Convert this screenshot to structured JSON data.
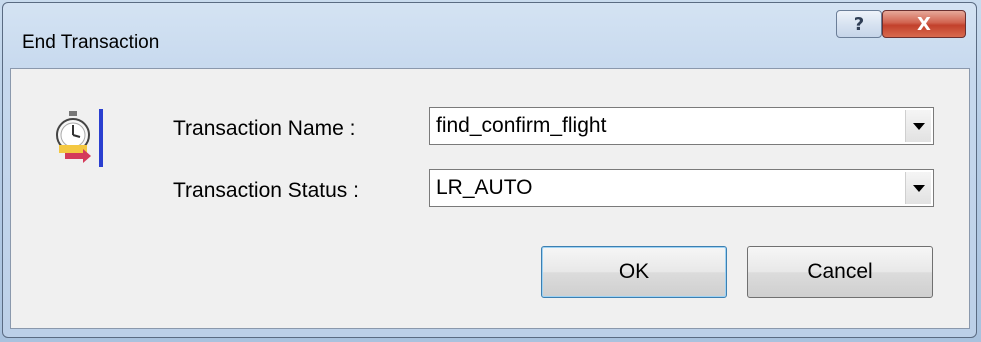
{
  "window": {
    "title": "End Transaction",
    "help_glyph": "?",
    "close_glyph": "X"
  },
  "icons": {
    "app": "transaction-end-icon"
  },
  "form": {
    "name_label": "Transaction Name :",
    "name_value": "find_confirm_flight",
    "status_label": "Transaction Status :",
    "status_value": "LR_AUTO"
  },
  "buttons": {
    "ok_label": "OK",
    "cancel_label": "Cancel"
  },
  "colors": {
    "accent_bar": "#2a3fd0",
    "close_red": "#c2412c"
  }
}
